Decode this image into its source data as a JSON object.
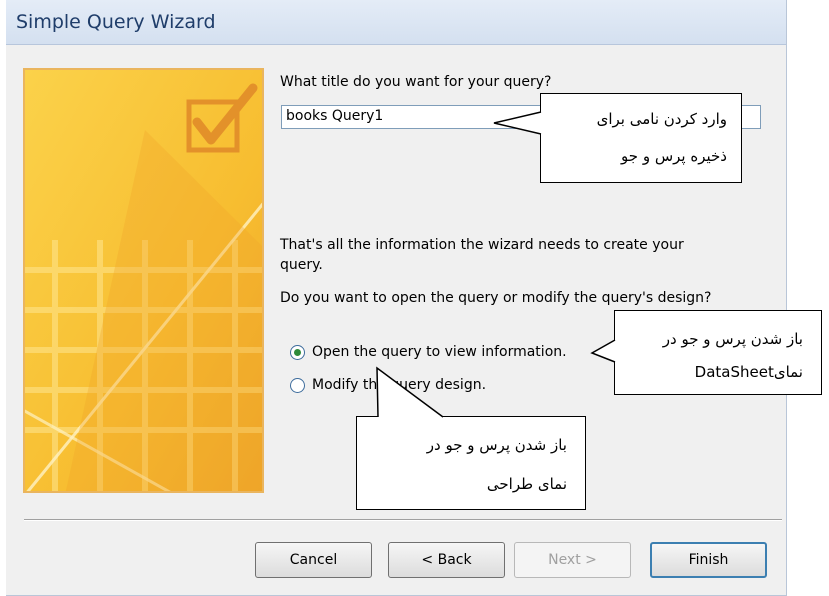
{
  "window": {
    "title": "Simple Query Wizard"
  },
  "form": {
    "title_question": "What title do you want for your query?",
    "title_value": "books Query1",
    "info_line": "That's all the information the wizard needs to create your query.",
    "info_line_part1": "That's all the information the wizard needs to create your",
    "info_line_part2": "query.",
    "open_question": "Do you want to open the query or modify the query's design?",
    "options": [
      {
        "label": "Open the query to view information.",
        "selected": true
      },
      {
        "label": "Modify the query design.",
        "selected": false
      }
    ]
  },
  "buttons": {
    "cancel": "Cancel",
    "back": "< Back",
    "next": "Next >",
    "finish": "Finish"
  },
  "callouts": {
    "save_name_line1": "وارد کردن نامی برای",
    "save_name_line2": "ذخیره پرس و جو",
    "open_datasheet_line1": "باز شدن پرس و جو در",
    "open_datasheet_line2": "نمایDataSheet",
    "design_view_line1": "باز شدن پرس و جو در",
    "design_view_line2": "نمای طراحی"
  },
  "colors": {
    "title_text": "#1f3d6a",
    "art_gold": "#f8c33a",
    "art_orange": "#e4942e",
    "art_border": "#eab55e"
  }
}
